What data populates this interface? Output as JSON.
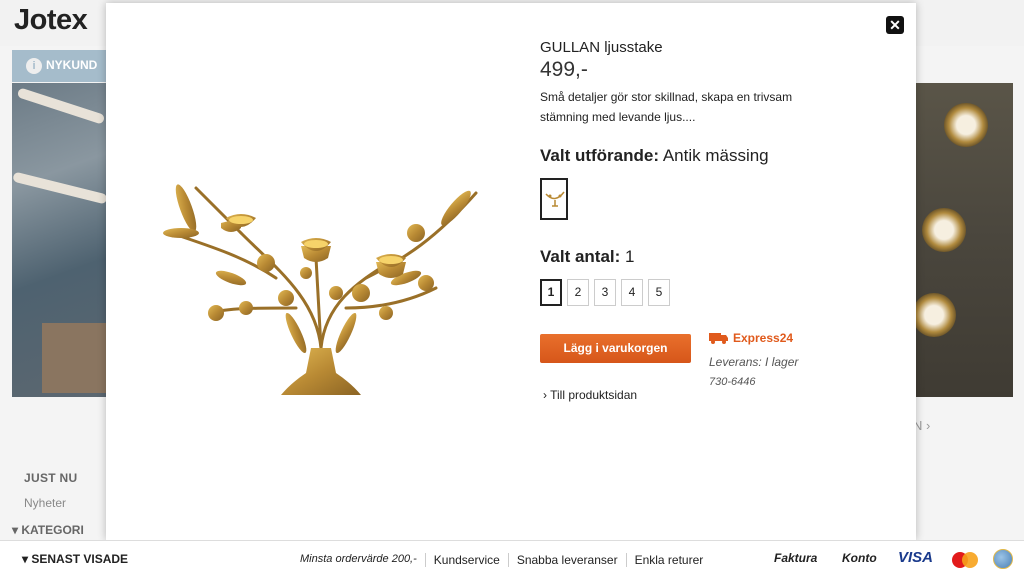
{
  "header": {
    "logo": "Jotex"
  },
  "banner": {
    "label": "NYKUND",
    "icon": "info-icon"
  },
  "background": {
    "pager_text": "N ›",
    "sidebar": {
      "just_nu": "JUST NU",
      "nyheter": "Nyheter",
      "kategori": "▾ KATEGORI"
    }
  },
  "modal": {
    "close_label": "✕",
    "product": {
      "title": "GULLAN ljusstake",
      "price": "499,-",
      "description": "Små detaljer gör stor skillnad, skapa en trivsam stämning med levande ljus....",
      "variant_heading_label": "Valt utförande:",
      "variant_value": "Antik mässing",
      "quantity_heading_label": "Valt antal:",
      "quantity_value": "1",
      "quantity_options": [
        "1",
        "2",
        "3",
        "4",
        "5"
      ],
      "selected_quantity": "1",
      "add_to_cart_label": "Lägg i varukorgen",
      "express_label": "Express24",
      "delivery_text": "Leverans: I lager",
      "article_number": "730-6446",
      "product_page_link": "› Till produktsidan"
    }
  },
  "footer": {
    "recently_viewed": "▾  SENAST VISADE",
    "links": [
      "Minsta ordervärde 200,-",
      "Kundservice",
      "Snabba leveranser",
      "Enkla returer"
    ],
    "payment_faktura": "Faktura",
    "payment_konto": "Konto",
    "payment_visa": "VISA"
  },
  "colors": {
    "accent_orange": "#e05a1c",
    "banner_blue": "#a5bccb",
    "visa_blue": "#1a3a8c"
  }
}
